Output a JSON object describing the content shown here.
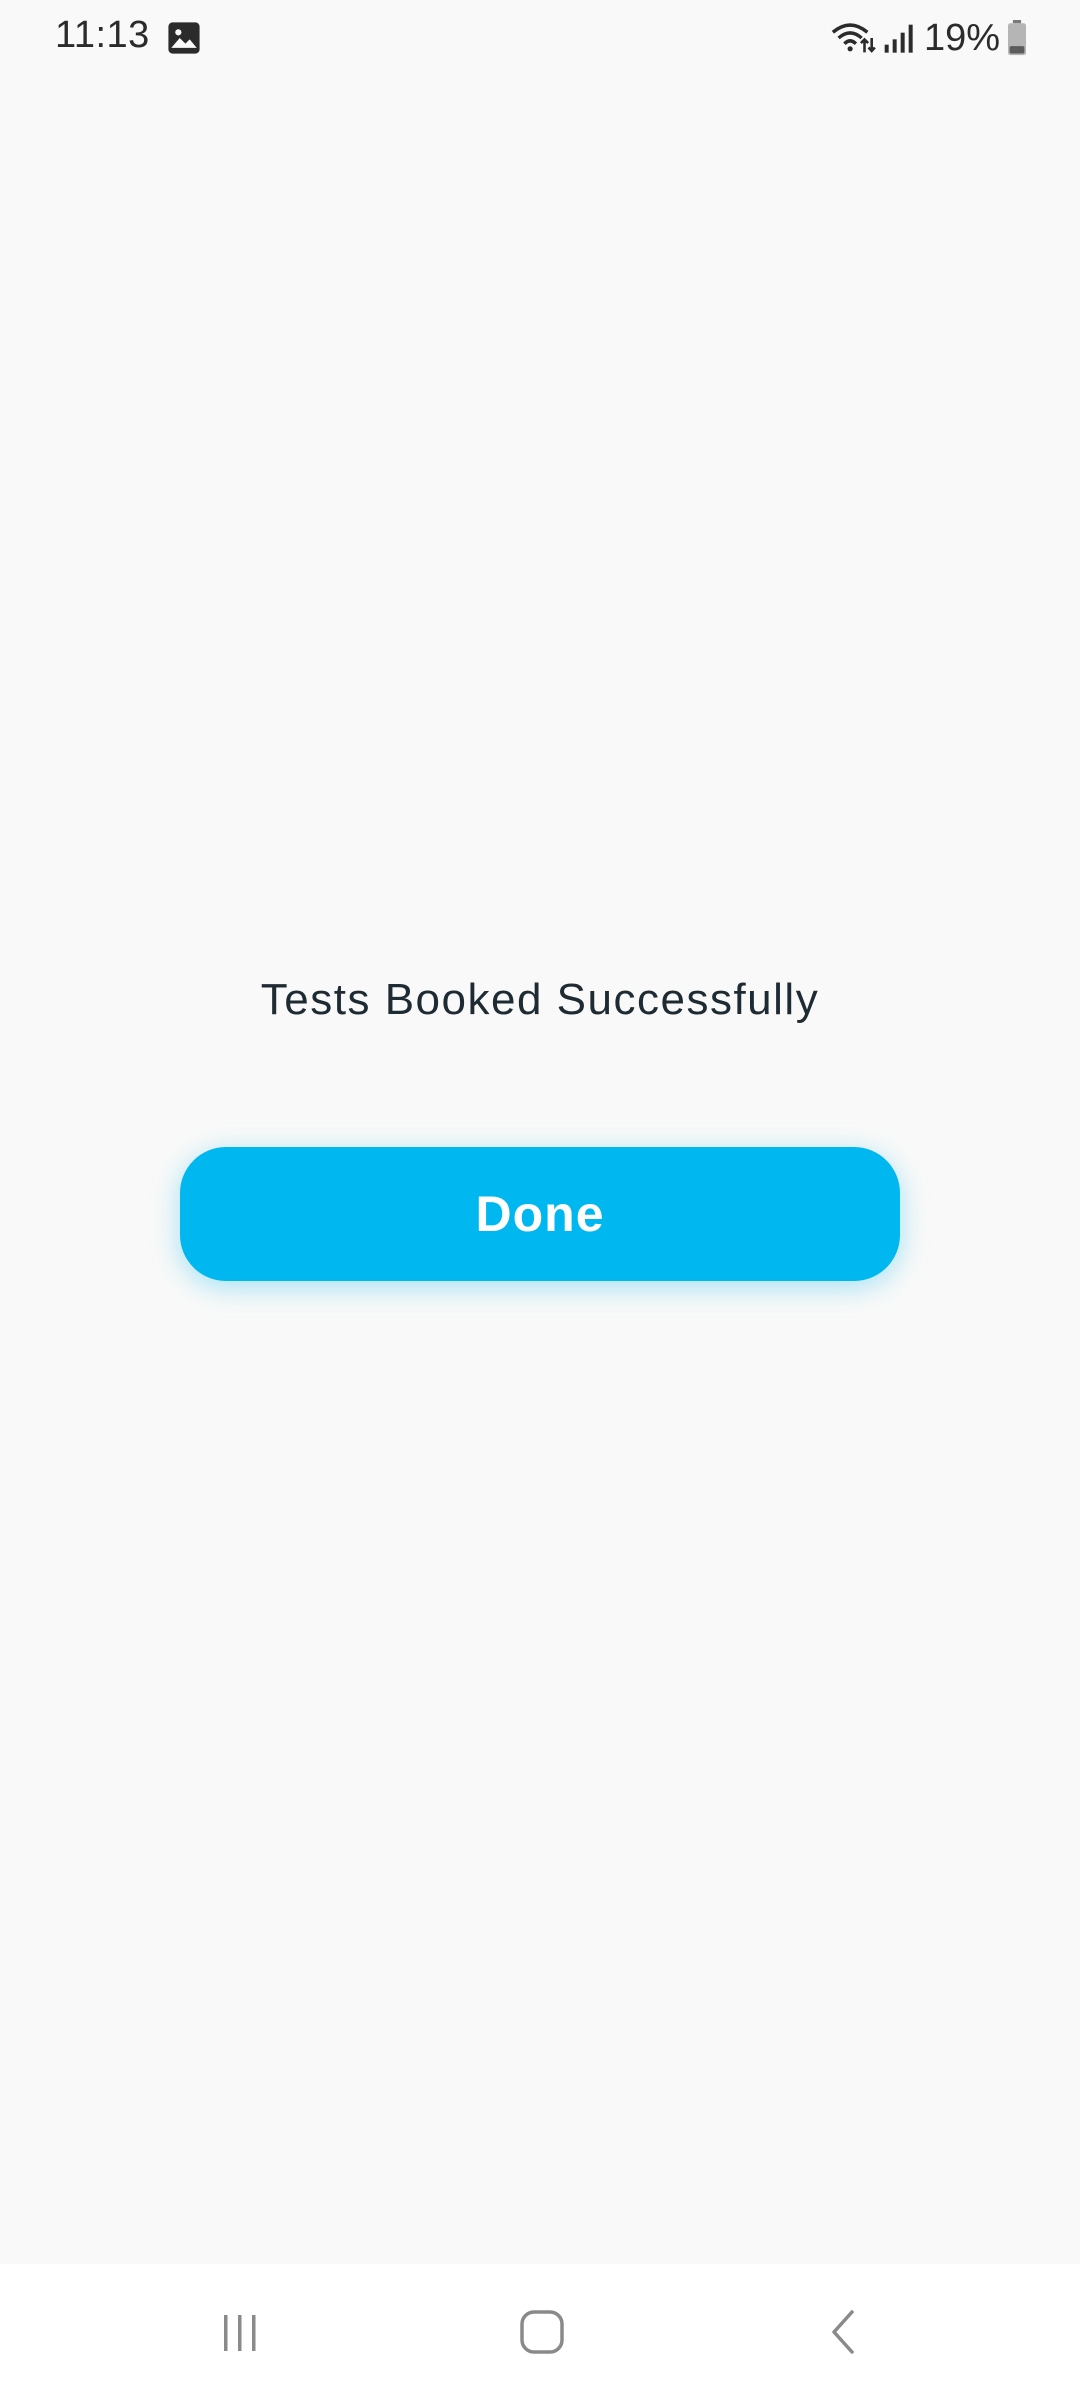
{
  "status_bar": {
    "time": "11:13",
    "battery_percent": "19%",
    "icons": [
      "gallery-icon",
      "wifi-icon",
      "signal-icon",
      "battery-icon"
    ]
  },
  "main": {
    "message": "Tests Booked Successfully",
    "done_label": "Done"
  },
  "nav_bar": {
    "buttons": [
      "recents-icon",
      "home-icon",
      "back-icon"
    ]
  },
  "colors": {
    "background": "#f9f9f9",
    "accent": "#00b7ef",
    "text": "#1f2b33"
  }
}
